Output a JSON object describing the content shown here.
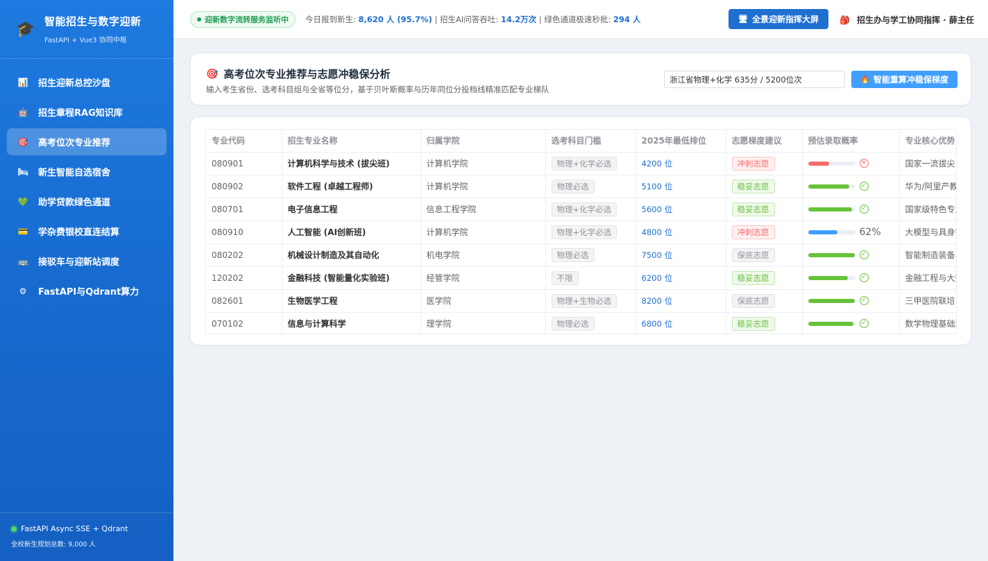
{
  "sidebar": {
    "title": "智能招生与数字迎新",
    "subtitle": "FastAPI + Vue3 协同中枢",
    "brand_icon": "graduation-cap-icon",
    "items": [
      {
        "label": "招生迎新总控沙盘",
        "icon": "chart-icon",
        "glyph": "📊",
        "active": false
      },
      {
        "label": "招生章程RAG知识库",
        "icon": "robot-icon",
        "glyph": "🤖",
        "active": false
      },
      {
        "label": "高考位次专业推荐",
        "icon": "target-icon",
        "glyph": "🎯",
        "active": true
      },
      {
        "label": "新生智能自选宿舍",
        "icon": "bed-icon",
        "glyph": "🛏",
        "active": false
      },
      {
        "label": "助学贷款绿色通道",
        "icon": "heart-icon",
        "glyph": "💚",
        "active": false
      },
      {
        "label": "学杂费银校直连结算",
        "icon": "card-icon",
        "glyph": "💳",
        "active": false
      },
      {
        "label": "接驳车与迎新站调度",
        "icon": "bus-station-icon",
        "glyph": "🚌",
        "active": false
      },
      {
        "label": "FastAPI与Qdrant算力",
        "icon": "gear-icon",
        "glyph": "⚙",
        "active": false
      }
    ],
    "footer_status": "FastAPI Async SSE + Qdrant",
    "footer_count": "全校新生规划总数: 9,000 人"
  },
  "header": {
    "live_badge": "迎新数字流转服务监听中",
    "stat1_label": "今日报到新生: ",
    "stat1_value": "8,620 人 (95.7%)",
    "stat2_label": " | 招生AI问答吞吐: ",
    "stat2_value": "14.2万次",
    "stat3_label": " | 绿色通道极速秒批: ",
    "stat3_value": "294 人",
    "screen_button": "全景迎新指挥大屏",
    "user": "招生办与学工协同指挥 · 薛主任"
  },
  "query": {
    "title": "高考位次专业推荐与志愿冲稳保分析",
    "description": "输入考生省份、选考科目组与全省等位分，基于贝叶斯概率与历年同位分投档线精准匹配专业梯队",
    "input_value": "浙江省物理+化学 635分 / 5200位次",
    "button": "智能重算冲稳保梯度"
  },
  "table": {
    "headers": [
      "专业代码",
      "招生专业名称",
      "归属学院",
      "选考科目门槛",
      "2025年最低排位",
      "志愿梯度建议",
      "预估录取概率",
      "专业核心优势"
    ],
    "rank_unit": "位",
    "rows": [
      {
        "code": "080901",
        "name": "计算机科学与技术 (拔尖班)",
        "college": "计算机学院",
        "subject": "物理+化学必选",
        "rank": "4200",
        "tier": "冲刺志愿",
        "tier_type": "chong",
        "prob": 0.45,
        "prob_color": "#f56c6c",
        "prob_status": "bad",
        "prob_text": "",
        "advantage": "国家一流拔尖"
      },
      {
        "code": "080902",
        "name": "软件工程 (卓越工程师)",
        "college": "计算机学院",
        "subject": "物理必选",
        "rank": "5100",
        "tier": "稳妥志愿",
        "tier_type": "wen",
        "prob": 0.88,
        "prob_color": "#67c23a",
        "prob_status": "ok",
        "prob_text": "",
        "advantage": "华为/阿里产教"
      },
      {
        "code": "080701",
        "name": "电子信息工程",
        "college": "信息工程学院",
        "subject": "物理+化学必选",
        "rank": "5600",
        "tier": "稳妥志愿",
        "tier_type": "wen",
        "prob": 0.93,
        "prob_color": "#67c23a",
        "prob_status": "ok",
        "prob_text": "",
        "advantage": "国家级特色专业"
      },
      {
        "code": "080910",
        "name": "人工智能 (AI创新班)",
        "college": "计算机学院",
        "subject": "物理+化学必选",
        "rank": "4800",
        "tier": "冲刺志愿",
        "tier_type": "chong",
        "prob": 0.62,
        "prob_color": "#409eff",
        "prob_status": "none",
        "prob_text": "62%",
        "advantage": "大模型与具身智能"
      },
      {
        "code": "080202",
        "name": "机械设计制造及其自动化",
        "college": "机电学院",
        "subject": "物理必选",
        "rank": "7500",
        "tier": "保底志愿",
        "tier_type": "bao",
        "prob": 0.99,
        "prob_color": "#67c23a",
        "prob_status": "ok",
        "prob_text": "",
        "advantage": "智能制造装备与"
      },
      {
        "code": "120202",
        "name": "金融科技 (智能量化实验班)",
        "college": "经管学院",
        "subject": "不限",
        "rank": "6200",
        "tier": "稳妥志愿",
        "tier_type": "wen",
        "prob": 0.85,
        "prob_color": "#67c23a",
        "prob_status": "ok",
        "prob_text": "",
        "advantage": "金融工程与大数据"
      },
      {
        "code": "082601",
        "name": "生物医学工程",
        "college": "医学院",
        "subject": "物理+生物必选",
        "rank": "8200",
        "tier": "保底志愿",
        "tier_type": "bao",
        "prob": 0.99,
        "prob_color": "#67c23a",
        "prob_status": "ok",
        "prob_text": "",
        "advantage": "三甲医院联培"
      },
      {
        "code": "070102",
        "name": "信息与计算科学",
        "college": "理学院",
        "subject": "物理必选",
        "rank": "6800",
        "tier": "稳妥志愿",
        "tier_type": "wen",
        "prob": 0.96,
        "prob_color": "#67c23a",
        "prob_status": "ok",
        "prob_text": "",
        "advantage": "数学物理基础深厚"
      }
    ]
  }
}
